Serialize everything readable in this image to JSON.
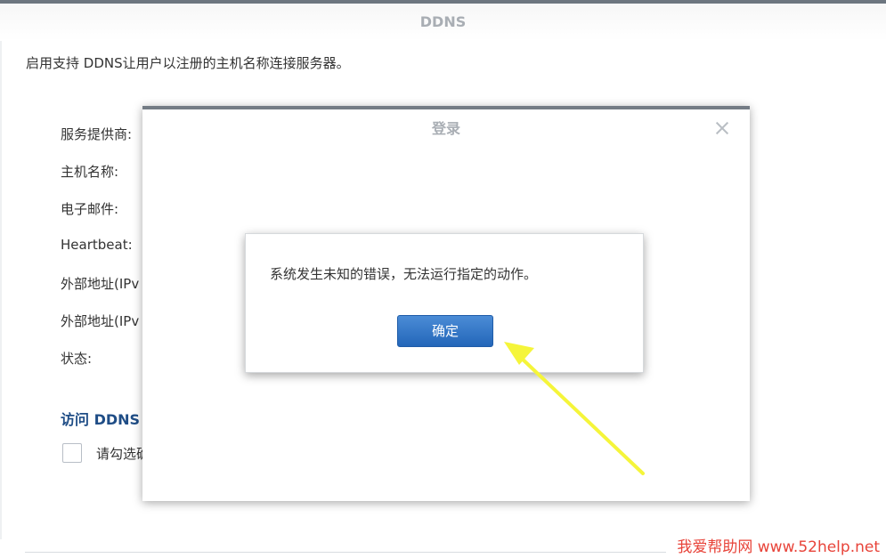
{
  "page": {
    "title": "DDNS",
    "description": "启用支持 DDNS让用户以注册的主机名称连接服务器。"
  },
  "form": {
    "labels": [
      "服务提供商:",
      "主机名称:",
      "电子邮件:",
      "Heartbeat:",
      "外部地址(IPv",
      "外部地址(IPv",
      "状态:"
    ]
  },
  "section": {
    "title": "访问 DDNS",
    "checkbox_label": "请勾选确"
  },
  "login_dialog": {
    "title": "登录"
  },
  "alert": {
    "message": "系统发生未知的错误，无法运行指定的动作。",
    "ok_label": "确定"
  },
  "annotation": {
    "arrow_color": "#f5f53a"
  },
  "watermark": {
    "text": "我爱帮助网 www.52help.net"
  },
  "colors": {
    "primary_button": "#2a6cbf",
    "section_title": "#1f4d86",
    "watermark": "#e8443a"
  }
}
